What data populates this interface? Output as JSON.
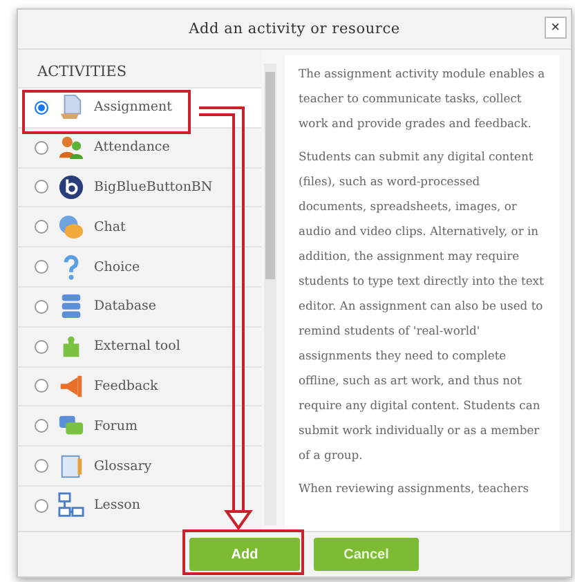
{
  "dialog": {
    "title": "Add an activity or resource",
    "close": "×"
  },
  "list": {
    "heading": "ACTIVITIES",
    "items": [
      {
        "label": "Assignment",
        "selected": true
      },
      {
        "label": "Attendance",
        "selected": false
      },
      {
        "label": "BigBlueButtonBN",
        "selected": false
      },
      {
        "label": "Chat",
        "selected": false
      },
      {
        "label": "Choice",
        "selected": false
      },
      {
        "label": "Database",
        "selected": false
      },
      {
        "label": "External tool",
        "selected": false
      },
      {
        "label": "Feedback",
        "selected": false
      },
      {
        "label": "Forum",
        "selected": false
      },
      {
        "label": "Glossary",
        "selected": false
      },
      {
        "label": "Lesson",
        "selected": false
      }
    ]
  },
  "description": [
    "The assignment activity module enables a teacher to communicate tasks, collect work and provide grades and feedback.",
    "Students can submit any digital content (files), such as word-processed documents, spreadsheets, images, or audio and video clips. Alternatively, or in addition, the assignment may require students to type text directly into the text editor. An assignment can also be used to remind students of 'real-world' assignments they need to complete offline, such as art work, and thus not require any digital content. Students can submit work individually or as a member of a group.",
    "When reviewing assignments, teachers"
  ],
  "buttons": [
    {
      "label": "Add",
      "kind": "primary"
    },
    {
      "label": "Cancel",
      "kind": "secondary"
    }
  ]
}
